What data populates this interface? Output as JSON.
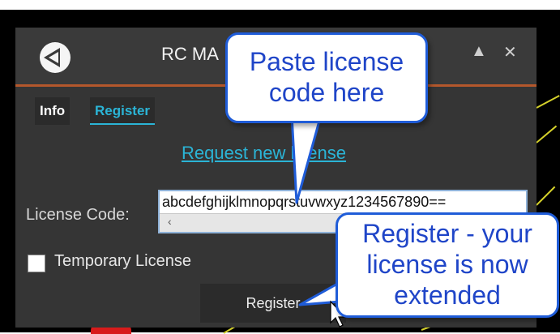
{
  "window": {
    "title": "RC MA",
    "tabs": [
      {
        "label": "Info",
        "selected": false
      },
      {
        "label": "Register",
        "selected": true
      }
    ],
    "request_link": "Request new license",
    "license_code_label": "License Code:",
    "license_code_value": "abcdefghijklmnopqrstuvwxyz1234567890==",
    "scroll_left": "‹",
    "temporary_label": "Temporary License",
    "temporary_checked": false,
    "register_button": "Register",
    "minimize_glyph": "▲",
    "close_glyph": "✕"
  },
  "callouts": {
    "paste": {
      "line1": "Paste license",
      "line2": "code here"
    },
    "register": {
      "line1": "Register - your",
      "line2": "license is now",
      "line3": "extended"
    }
  },
  "colors": {
    "accent": "#b4572c",
    "link": "#2bb4d6",
    "callout_text": "#1f45c8",
    "callout_border": "#1f5cd8"
  }
}
